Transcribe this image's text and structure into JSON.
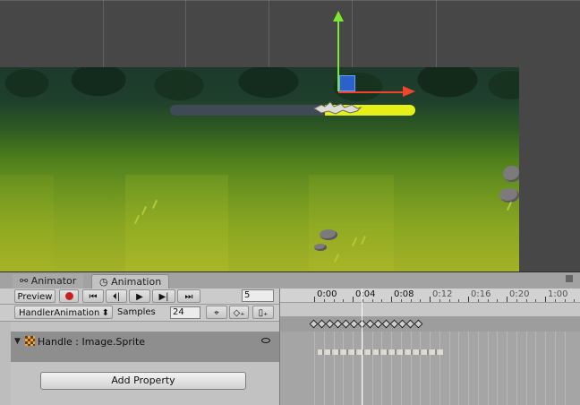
{
  "tabs": [
    {
      "label": "Animator",
      "icon": "animator-icon"
    },
    {
      "label": "Animation",
      "icon": "clock-icon",
      "active": true
    }
  ],
  "toolbar": {
    "preview_label": "Preview",
    "record_icon": "record-icon",
    "first_key_icon": "⏮",
    "prev_key_icon": "⏴|",
    "play_icon": "▶",
    "next_key_icon": "▶|",
    "last_key_icon": "⏭",
    "current_frame": "5"
  },
  "clip": {
    "name": "HandlerAnimation",
    "samples_label": "Samples",
    "samples_value": "24"
  },
  "properties": [
    {
      "label": "Handle : Image.Sprite"
    }
  ],
  "add_property_label": "Add Property",
  "timeline": {
    "ticks": [
      "0:00",
      "0:04",
      "0:08",
      "0:12",
      "0:16",
      "0:20",
      "1:00"
    ],
    "keyframe_count": 14
  },
  "scene": {
    "progress": 0.37,
    "accent_color": "#e6ef18",
    "track_color": "#3f4a55"
  }
}
